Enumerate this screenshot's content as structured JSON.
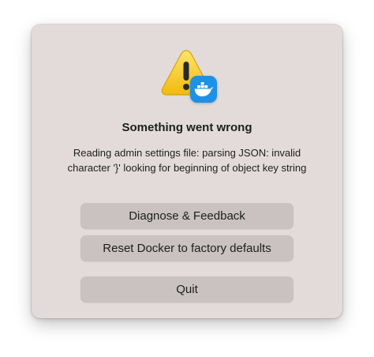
{
  "dialog": {
    "icon": "warning-triangle-icon",
    "badge_icon": "docker-whale-icon",
    "title": "Something went wrong",
    "message_line1": "Reading admin settings file: parsing JSON: invalid",
    "message_line2": "character '}' looking for beginning of object key string",
    "buttons": {
      "diagnose": "Diagnose & Feedback",
      "reset": "Reset Docker to factory defaults",
      "quit": "Quit"
    }
  },
  "colors": {
    "dialog_background": "#e2dbd9",
    "button_background": "#c9c2c0",
    "warning_yellow": "#f7c51e",
    "docker_blue": "#1d91e6"
  }
}
